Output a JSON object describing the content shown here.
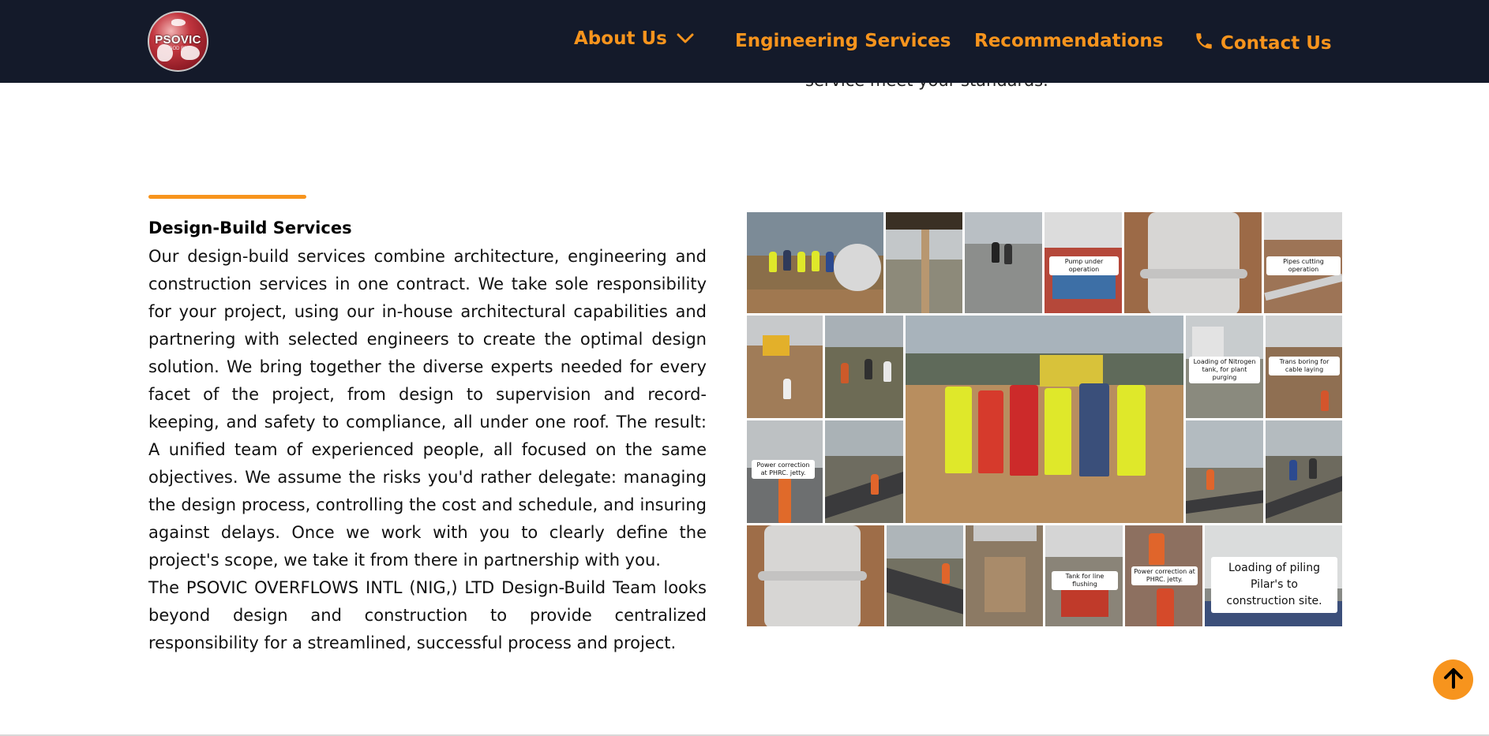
{
  "header": {
    "logo_text": "PSOVIC",
    "logo_subtext": "GOD BE",
    "nav": {
      "about": "About Us",
      "engineering": "Engineering Services",
      "recommendations": "Recommendations",
      "contact": "Contact Us"
    }
  },
  "prev_section_tail": "service meet your standards.",
  "section": {
    "title": "Design-Build Services",
    "paragraphs": [
      "Our design-build services combine architecture, engineering and construction services in one contract. We take sole responsibility for your project, using our in-house architectural capabilities and partnering with selected engineers to create the optimal design solution. We bring together the diverse experts needed for every facet of the project, from design to supervision and record-keeping, and safety to compliance, all under one roof. The result: A unified team of experienced people, all focused on the same objectives. We assume the risks you'd rather delegate: managing the design process, controlling the cost and schedule, and insuring against delays. Once we work with you to clearly define the project's scope, we take it from there in partnership with you.",
      "The PSOVIC OVERFLOWS INTL (NIG,) LTD Design-Build Team looks beyond design and construction to provide centralized responsibility for a streamlined, successful process and project."
    ]
  },
  "collage": {
    "captions": {
      "pump": "Pump under operation",
      "pipes_cutting": "Pipes cutting operation",
      "nitrogen": "Loading of Nitrogen tank, for plant purging",
      "trans_boring": "Trans boring for cable laying",
      "power_correction_1": "Power correction at PHRC. jetty.",
      "tank_flushing": "Tank for line flushing",
      "power_correction_2": "Power correction at PHRC. jetty.",
      "piling": "Loading of piling Pilar's to construction site."
    }
  },
  "colors": {
    "navbar_bg": "#141a2a",
    "accent": "#f7941d",
    "text": "#111111"
  },
  "icons": {
    "chevron": "chevron-down-icon",
    "phone": "phone-icon",
    "back_to_top": "arrow-up-icon"
  }
}
